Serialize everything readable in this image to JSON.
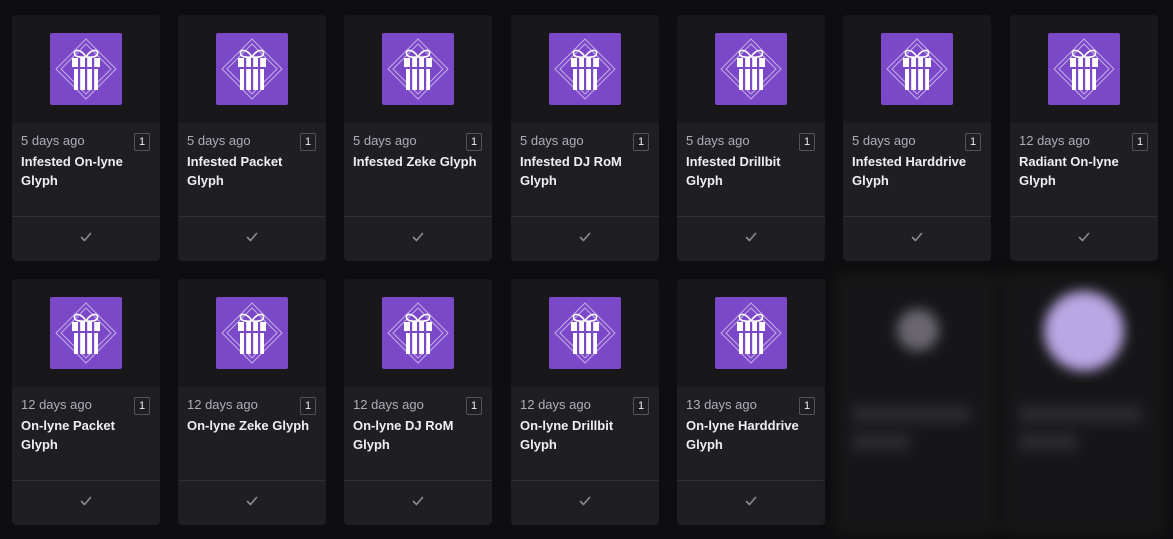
{
  "cards": [
    {
      "time": "5 days ago",
      "qty": "1",
      "name": "Infested On-lyne Glyph"
    },
    {
      "time": "5 days ago",
      "qty": "1",
      "name": "Infested Packet Glyph"
    },
    {
      "time": "5 days ago",
      "qty": "1",
      "name": "Infested Zeke Glyph"
    },
    {
      "time": "5 days ago",
      "qty": "1",
      "name": "Infested DJ RoM Glyph"
    },
    {
      "time": "5 days ago",
      "qty": "1",
      "name": "Infested Drillbit Glyph"
    },
    {
      "time": "5 days ago",
      "qty": "1",
      "name": "Infested Harddrive Glyph"
    },
    {
      "time": "12 days ago",
      "qty": "1",
      "name": "Radiant On-lyne Glyph"
    },
    {
      "time": "12 days ago",
      "qty": "1",
      "name": "On-lyne Packet Glyph"
    },
    {
      "time": "12 days ago",
      "qty": "1",
      "name": "On-lyne Zeke Glyph"
    },
    {
      "time": "12 days ago",
      "qty": "1",
      "name": "On-lyne DJ RoM Glyph"
    },
    {
      "time": "12 days ago",
      "qty": "1",
      "name": "On-lyne Drillbit Glyph"
    },
    {
      "time": "13 days ago",
      "qty": "1",
      "name": "On-lyne Harddrive Glyph"
    }
  ],
  "icons": {
    "item": "gift-icon",
    "claimed": "checkmark-icon"
  },
  "colors": {
    "page_background": "#0e0e10",
    "card_background": "#1f1f23",
    "icon_background": "#7b48c8",
    "text_primary": "#efeff1",
    "text_secondary": "#adadb8"
  }
}
